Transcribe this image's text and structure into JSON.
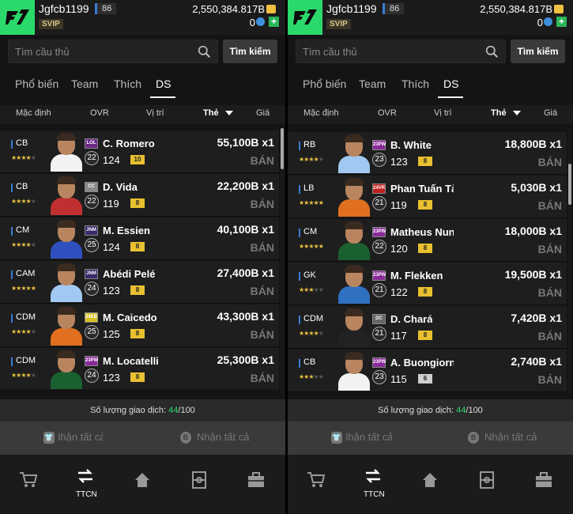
{
  "colors": {
    "brand": "#2bd96b",
    "accent_blue": "#3a7bd5",
    "star": "#e8c040"
  },
  "panels": [
    {
      "header": {
        "username": "Jgfcb1199",
        "level": "86",
        "svip": "SVIP",
        "coins": "2,550,384.817B",
        "bp": "0"
      },
      "search": {
        "placeholder": "Tìm cầu thủ",
        "button": "Tìm kiếm"
      },
      "tabs": [
        "Phổ biến",
        "Team",
        "Thích",
        "DS"
      ],
      "columns": [
        "Mặc định",
        "OVR",
        "Vị trí",
        "Thẻ",
        "Giá"
      ],
      "rows": [
        {
          "pos": "CB",
          "stars": 4,
          "badge": "LOL",
          "ovrc": "22",
          "name": "C. Romero",
          "ovr": "124",
          "upg": "10",
          "price": "55,100B x1",
          "sell": "BÁN"
        },
        {
          "pos": "CB",
          "stars": 4,
          "badge": "CC",
          "ovrc": "22",
          "name": "D. Vida",
          "ovr": "119",
          "upg": "8",
          "price": "22,200B x1",
          "sell": "BÁN"
        },
        {
          "pos": "CM",
          "stars": 4,
          "badge": "JNM",
          "ovrc": "25",
          "name": "M. Essien",
          "ovr": "124",
          "upg": "8",
          "price": "40,100B x1",
          "sell": "BÁN"
        },
        {
          "pos": "CAM",
          "stars": 5,
          "badge": "JNM",
          "ovrc": "24",
          "name": "Abédi Pelé",
          "ovr": "123",
          "upg": "8",
          "price": "27,400B x1",
          "sell": "BÁN"
        },
        {
          "pos": "CDM",
          "stars": 4,
          "badge": "24EB",
          "ovrc": "25",
          "name": "M. Caicedo",
          "ovr": "125",
          "upg": "8",
          "price": "43,300B x1",
          "sell": "BÁN"
        },
        {
          "pos": "CDM",
          "stars": 4,
          "badge": "23PW",
          "ovrc": "24",
          "name": "M. Locatelli",
          "ovr": "123",
          "upg": "8",
          "price": "25,300B x1",
          "sell": "BÁN"
        }
      ],
      "trades": {
        "label": "Số lượng giao dịch: ",
        "used": "44",
        "total": "/100"
      },
      "actions": [
        "Nhận tất cả",
        "Nhận tất cả"
      ],
      "nav": {
        "active_label": "TTCN"
      }
    },
    {
      "header": {
        "username": "Jgfcb1199",
        "level": "86",
        "svip": "SVIP",
        "coins": "2,550,384.817B",
        "bp": "0"
      },
      "search": {
        "placeholder": "Tìm cầu thủ",
        "button": "Tìm kiếm"
      },
      "tabs": [
        "Phổ biến",
        "Team",
        "Thích",
        "DS"
      ],
      "columns": [
        "Mặc định",
        "OVR",
        "Vị trí",
        "Thẻ",
        "Giá"
      ],
      "rows": [
        {
          "pos": "RB",
          "stars": 4,
          "badge": "23PW",
          "ovrc": "23",
          "name": "B. White",
          "ovr": "123",
          "upg": "8",
          "price": "18,800B x1",
          "sell": "BÁN"
        },
        {
          "pos": "LB",
          "stars": 5,
          "badge": "24VR",
          "ovrc": "21",
          "name": "Phan Tuấn Tài",
          "ovr": "119",
          "upg": "8",
          "price": "5,030B x1",
          "sell": "BÁN"
        },
        {
          "pos": "CM",
          "stars": 5,
          "badge": "23PW",
          "ovrc": "22",
          "name": "Matheus Nunes",
          "ovr": "120",
          "upg": "8",
          "price": "18,000B x1",
          "sell": "BÁN"
        },
        {
          "pos": "GK",
          "stars": 3,
          "badge": "23PW",
          "ovrc": "21",
          "name": "M. Flekken",
          "ovr": "122",
          "upg": "8",
          "price": "19,500B x1",
          "sell": "BÁN"
        },
        {
          "pos": "CDM",
          "stars": 4,
          "badge": "DC",
          "ovrc": "21",
          "name": "D. Chará",
          "ovr": "117",
          "upg": "8",
          "price": "7,420B x1",
          "sell": "BÁN"
        },
        {
          "pos": "CB",
          "stars": 3,
          "badge": "23PW",
          "ovrc": "23",
          "name": "A. Buongiorno",
          "ovr": "115",
          "upg": "6",
          "price": "2,740B x1",
          "sell": "BÁN"
        }
      ],
      "trades": {
        "label": "Số lượng giao dịch: ",
        "used": "44",
        "total": "/100"
      },
      "actions": [
        "Nhận tất cả",
        "Nhận tất cả"
      ],
      "nav": {
        "active_label": "TTCN"
      }
    }
  ]
}
